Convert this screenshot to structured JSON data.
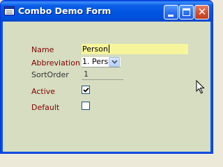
{
  "window": {
    "title": "Combo Demo Form"
  },
  "form": {
    "name_label": "Name",
    "name_value": "Person",
    "abbreviation_label": "Abbreviation",
    "abbreviation_value": "1. Pers",
    "sortorder_label": "SortOrder",
    "sortorder_value": "1",
    "active_label": "Active",
    "active_checked": true,
    "default_label": "Default",
    "default_checked": false
  },
  "icons": {
    "app": "form-icon",
    "minimize": "minimize-icon",
    "maximize": "maximize-icon",
    "close": "close-icon",
    "dropdown": "chevron-down-icon",
    "check": "checkmark-icon",
    "cursor": "mouse-pointer-icon"
  },
  "colors": {
    "titlebar": "#0054E3",
    "form_background": "#D6DDC1",
    "label_text": "#800000",
    "focused_input": "#F7F59C"
  }
}
